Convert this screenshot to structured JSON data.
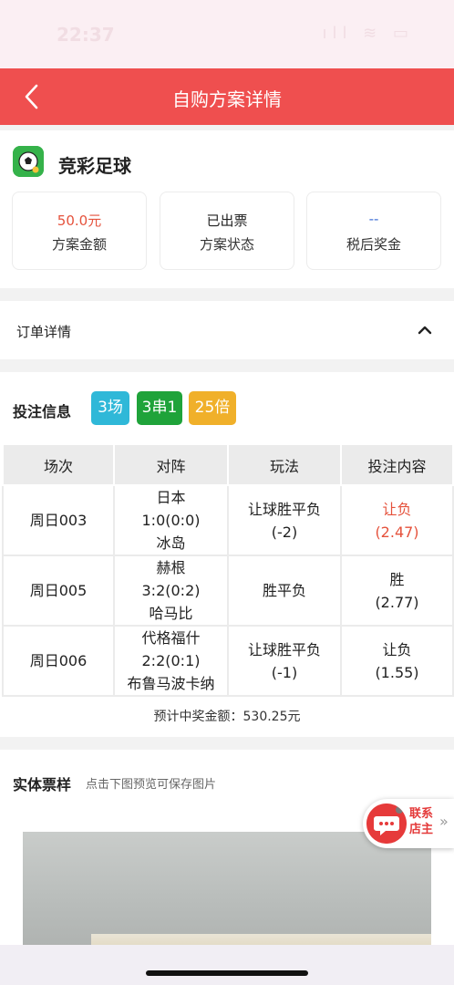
{
  "status_bar": {
    "time": "22:37",
    "icons": "ıll ≋ ▭"
  },
  "header": {
    "title": "自购方案详情",
    "back_icon": "chevron-left-icon"
  },
  "summary": {
    "lottery_name": "竞彩足球",
    "logo_icon": "soccer-ball-icon",
    "stats": [
      {
        "value": "50.0元",
        "label": "方案金额",
        "color": "#e5523c"
      },
      {
        "value": "已出票",
        "label": "方案状态",
        "color": "#222222"
      },
      {
        "value": "--",
        "label": "税后奖金",
        "color": "#3f6fd6"
      }
    ]
  },
  "order": {
    "title": "订单详情",
    "toggle_icon": "chevron-up-icon"
  },
  "bet": {
    "title": "投注信息",
    "tags": [
      {
        "text": "3场",
        "color": "#2fb8d8"
      },
      {
        "text": "3串1",
        "color": "#1fa33a"
      },
      {
        "text": "25倍",
        "color": "#f0b02a"
      }
    ],
    "columns": [
      "场次",
      "对阵",
      "玩法",
      "投注内容"
    ],
    "rows": [
      {
        "match_no": "周日003",
        "home": "日本",
        "score": "1:0(0:0)",
        "away": "冰岛",
        "play": "让球胜平负",
        "handicap": "(-2)",
        "pick": "让负",
        "odds": "(2.47)",
        "highlight": true
      },
      {
        "match_no": "周日005",
        "home": "赫根",
        "score": "3:2(0:2)",
        "away": "哈马比",
        "play": "胜平负",
        "handicap": "",
        "pick": "胜",
        "odds": "(2.77)",
        "highlight": false
      },
      {
        "match_no": "周日006",
        "home": "代格福什",
        "score": "2:2(0:1)",
        "away": "布鲁马波卡纳",
        "play": "让球胜平负",
        "handicap": "(-1)",
        "pick": "让负",
        "odds": "(1.55)",
        "highlight": false
      }
    ],
    "expected_prize": "预计中奖金额：530.25元"
  },
  "ticket": {
    "title": "实体票样",
    "hint": "点击下图预览可保存图片"
  },
  "contact": {
    "label": "联系店主",
    "icon": "chat-bubble-icon",
    "arrow": "»"
  }
}
